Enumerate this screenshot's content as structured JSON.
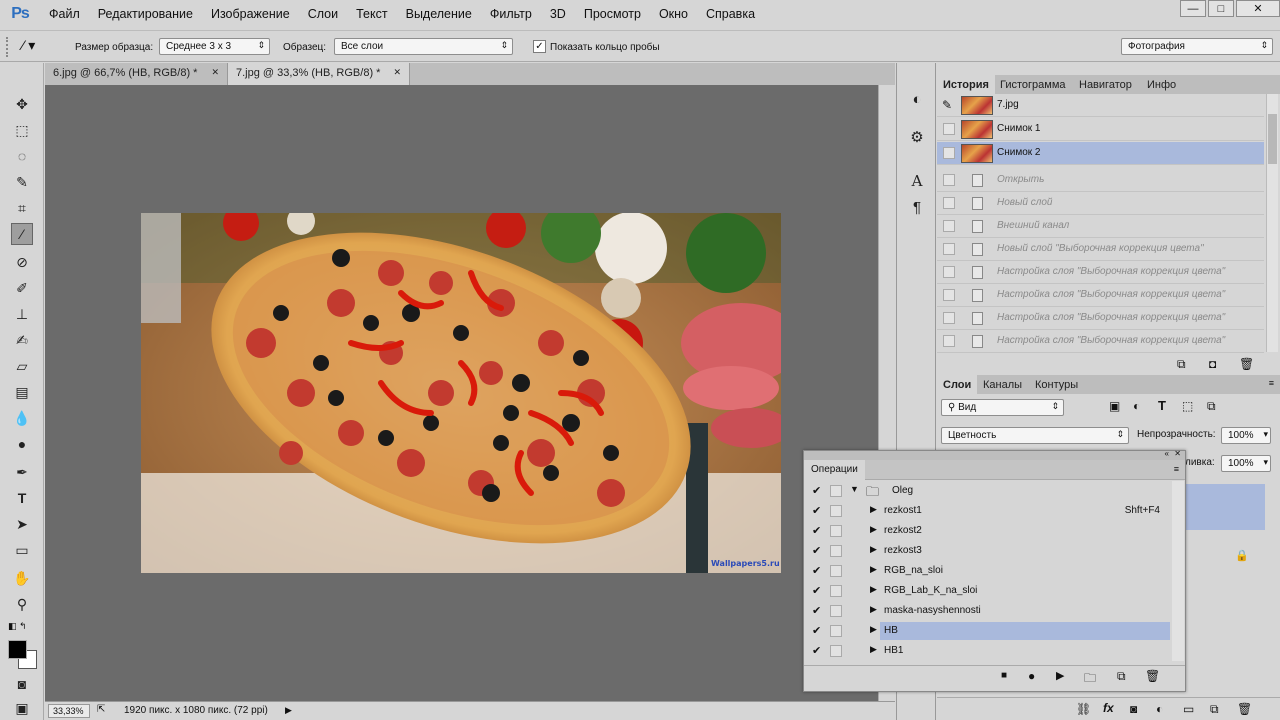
{
  "app": {
    "logo": "Ps"
  },
  "menu": [
    "Файл",
    "Редактирование",
    "Изображение",
    "Слои",
    "Текст",
    "Выделение",
    "Фильтр",
    "3D",
    "Просмотр",
    "Окно",
    "Справка"
  ],
  "window_buttons": {
    "minimize": "—",
    "maximize": "□",
    "close": "✕"
  },
  "options": {
    "sample_size_label": "Размер образца:",
    "sample_size_value": "Среднее 3 x 3",
    "sample_label": "Образец:",
    "sample_value": "Все слои",
    "show_ring_label": "Показать кольцо пробы",
    "show_ring_checked": "✓",
    "workspace": "Фотография"
  },
  "tabs": [
    {
      "label": "6.jpg @ 66,7% (HB, RGB/8) *",
      "close": "✕"
    },
    {
      "label": "7.jpg @ 33,3% (HB, RGB/8) *",
      "close": "✕"
    }
  ],
  "status": {
    "zoom": "33,33%",
    "doc_info": "1920 пикс. x 1080 пикс. (72 ppi)"
  },
  "history_panel": {
    "tabs": [
      "История",
      "Гистограмма",
      "Навигатор",
      "Инфо"
    ],
    "rows": [
      {
        "label": "7.jpg",
        "type": "snapshot"
      },
      {
        "label": "Снимок 1",
        "type": "snapshot"
      },
      {
        "label": "Снимок 2",
        "type": "snapshot",
        "selected": true
      },
      {
        "label": "Открыть",
        "type": "step"
      },
      {
        "label": "Новый слой",
        "type": "step"
      },
      {
        "label": "Внешний канал",
        "type": "step"
      },
      {
        "label": "Новый слой \"Выборочная коррекция цвета\"",
        "type": "step"
      },
      {
        "label": "Настройка слоя \"Выборочная коррекция цвета\"",
        "type": "step"
      },
      {
        "label": "Настройка слоя \"Выборочная коррекция цвета\"",
        "type": "step"
      },
      {
        "label": "Настройка слоя \"Выборочная коррекция цвета\"",
        "type": "step"
      },
      {
        "label": "Настройка слоя \"Выборочная коррекция цвета\"",
        "type": "step"
      }
    ]
  },
  "layers_panel": {
    "tabs": [
      "Слои",
      "Каналы",
      "Контуры"
    ],
    "filter": "Вид",
    "blend_mode": "Цветность",
    "opacity_label": "Непрозрачность:",
    "opacity_value": "100%",
    "fill_label": "ливка:",
    "fill_value": "100%"
  },
  "actions_panel": {
    "title": "Операции",
    "set_name": "Oleg",
    "items": [
      {
        "name": "rezkost1",
        "shortcut": "Shft+F4"
      },
      {
        "name": "rezkost2",
        "shortcut": ""
      },
      {
        "name": "rezkost3",
        "shortcut": ""
      },
      {
        "name": "RGB_na_sloi",
        "shortcut": ""
      },
      {
        "name": "RGB_Lab_K_na_sloi",
        "shortcut": ""
      },
      {
        "name": "maska-nasyshennosti",
        "shortcut": ""
      },
      {
        "name": "HB",
        "shortcut": "",
        "selected": true
      },
      {
        "name": "HB1",
        "shortcut": ""
      }
    ]
  },
  "image_watermark": "Wallpapers5.ru",
  "colors": {
    "selection": "#a9b9dc",
    "canvas_bg": "#6b6b6b",
    "panel_bg": "#d6d6d6"
  }
}
